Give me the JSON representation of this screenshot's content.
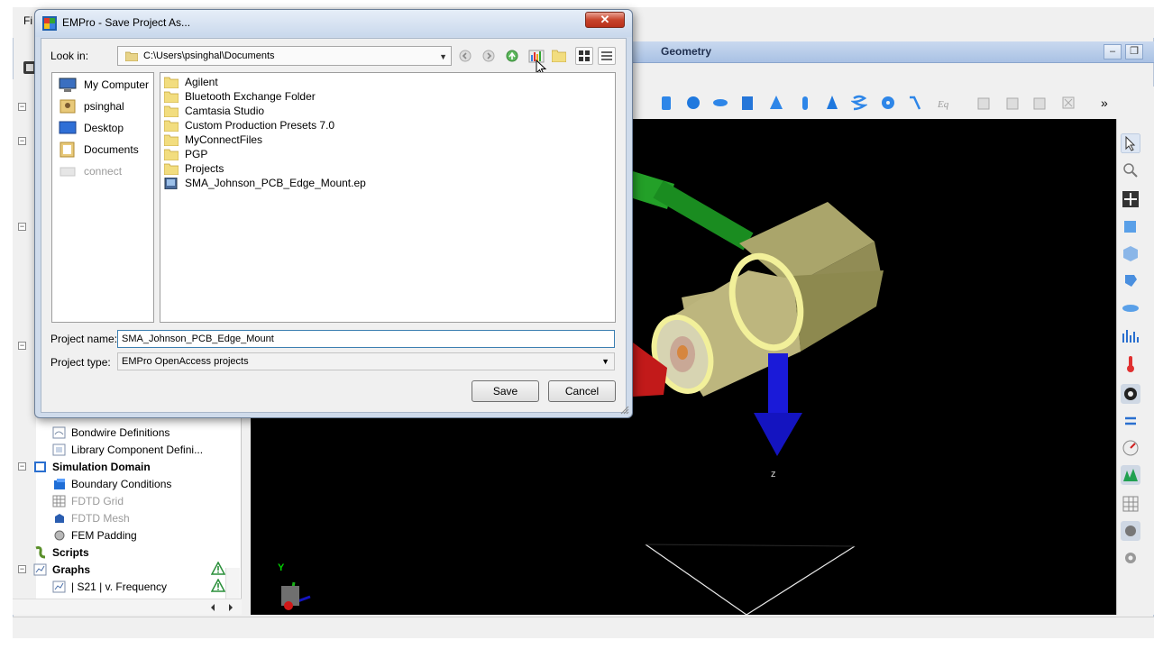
{
  "app": {
    "menu_file": "Fi",
    "geometry_title": "Geometry",
    "axis_z": "z",
    "axis_y": "Y"
  },
  "tree": {
    "items": [
      {
        "label": "Bondwire Definitions",
        "icon": "bondwire-icon",
        "disabled": false
      },
      {
        "label": "Library Component Defini...",
        "icon": "library-icon",
        "disabled": false
      },
      {
        "label": "Simulation Domain",
        "icon": "simulation-domain-icon",
        "disabled": false,
        "bold": true
      },
      {
        "label": "Boundary Conditions",
        "icon": "boundary-icon",
        "disabled": false
      },
      {
        "label": "FDTD Grid",
        "icon": "grid-icon",
        "disabled": true
      },
      {
        "label": "FDTD Mesh",
        "icon": "mesh-icon",
        "disabled": true
      },
      {
        "label": "FEM Padding",
        "icon": "padding-icon",
        "disabled": false
      },
      {
        "label": "Scripts",
        "icon": "scripts-icon",
        "disabled": false,
        "bold": true
      },
      {
        "label": "Graphs",
        "icon": "graphs-icon",
        "disabled": false,
        "bold": true
      },
      {
        "label": "| S21 | v. Frequency",
        "icon": "graph-icon",
        "disabled": false
      }
    ]
  },
  "dialog": {
    "title": "EMPro - Save Project As...",
    "close_label": "✕",
    "look_in_label": "Look in:",
    "look_in_path": "C:\\Users\\psinghal\\Documents",
    "places": [
      {
        "label": "My Computer",
        "icon": "computer-icon",
        "disabled": false
      },
      {
        "label": "psinghal",
        "icon": "user-folder-icon",
        "disabled": false
      },
      {
        "label": "Desktop",
        "icon": "desktop-icon",
        "disabled": false
      },
      {
        "label": "Documents",
        "icon": "documents-icon",
        "disabled": false
      },
      {
        "label": "connect",
        "icon": "drive-icon",
        "disabled": true
      }
    ],
    "files": [
      {
        "name": "Agilent",
        "type": "folder"
      },
      {
        "name": "Bluetooth Exchange Folder",
        "type": "folder"
      },
      {
        "name": "Camtasia Studio",
        "type": "folder"
      },
      {
        "name": "Custom Production Presets 7.0",
        "type": "folder"
      },
      {
        "name": "MyConnectFiles",
        "type": "folder"
      },
      {
        "name": "PGP",
        "type": "folder"
      },
      {
        "name": "Projects",
        "type": "folder"
      },
      {
        "name": "SMA_Johnson_PCB_Edge_Mount.ep",
        "type": "project"
      }
    ],
    "project_name_label": "Project name:",
    "project_name_value": "SMA_Johnson_PCB_Edge_Mount",
    "project_type_label": "Project type:",
    "project_type_value": "EMPro OpenAccess projects",
    "save_label": "Save",
    "cancel_label": "Cancel"
  },
  "colors": {
    "dialog_frame": "#cfdbeb",
    "viewport": "#000000",
    "connector": "#b9b27a",
    "ring": "#f2f09a",
    "axis_green": "#1fa01f",
    "axis_blue": "#1a1ad8",
    "axis_red": "#d01818"
  }
}
